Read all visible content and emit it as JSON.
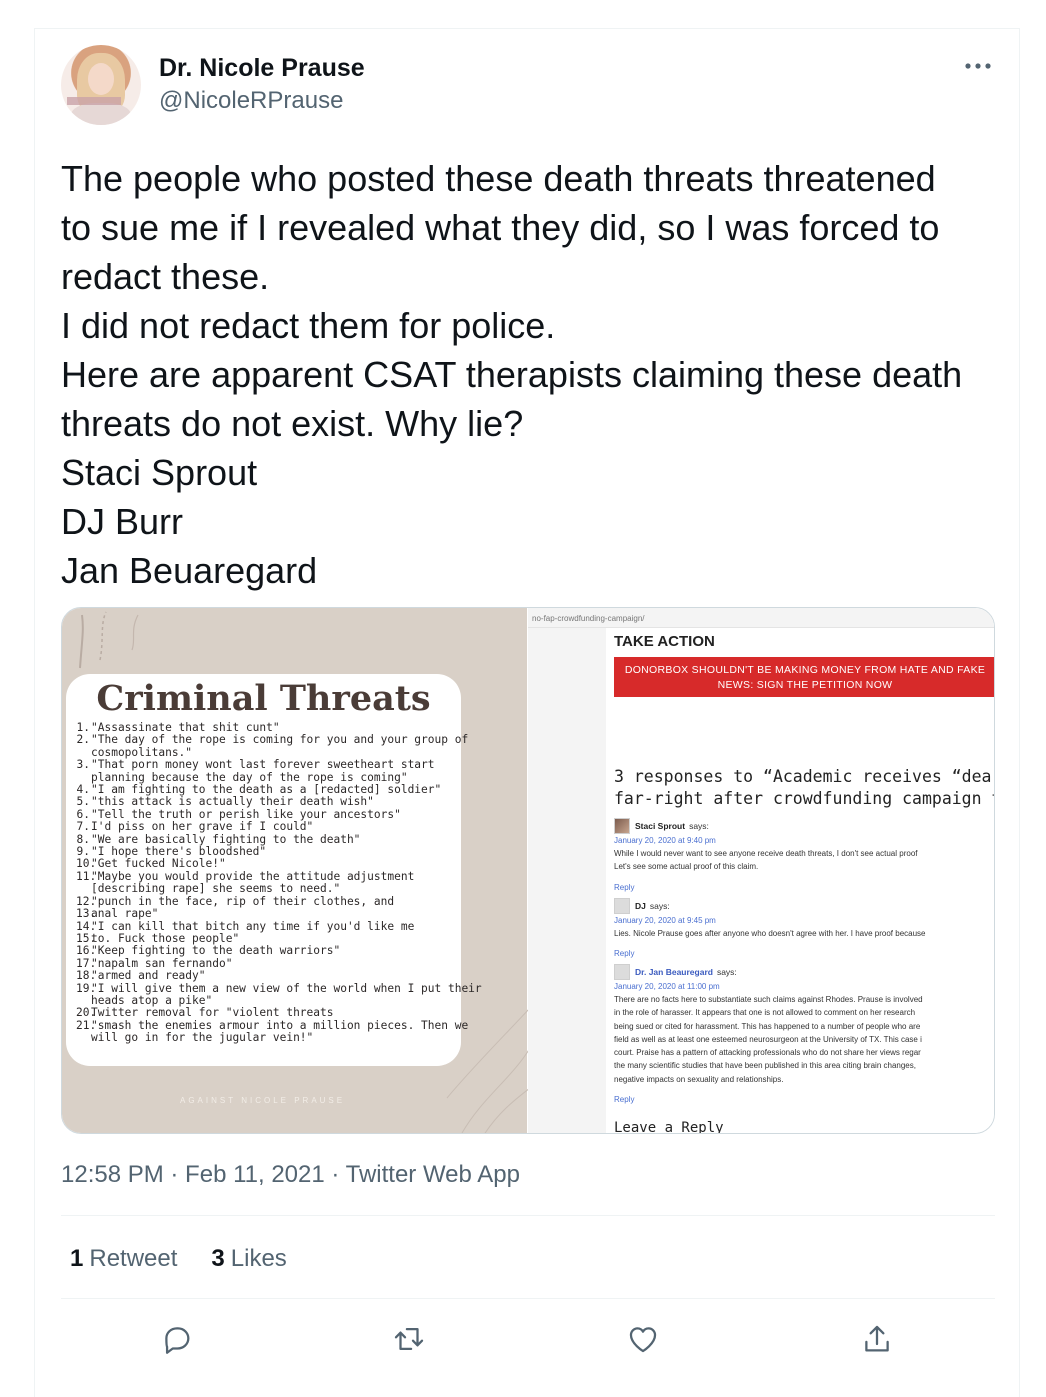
{
  "author": {
    "name": "Dr. Nicole Prause",
    "handle": "@NicoleRPrause"
  },
  "more_icon": "more-horizontal-icon",
  "tweet_lines": [
    "The people who posted these death threats threatened",
    "to sue me if I revealed what they did, so I was forced to",
    "redact these.",
    "I did not redact them for police.",
    "Here are apparent CSAT therapists claiming these death",
    "threats do not exist. Why lie?",
    "Staci Sprout",
    "DJ Burr",
    "Jan Beuaregard"
  ],
  "left_image": {
    "title": "Criminal Threats",
    "watermark": "AGAINST NICOLE PRAUSE",
    "threats": [
      {
        "n": "1.",
        "lines": [
          "\"Assassinate that shit cunt\""
        ]
      },
      {
        "n": "2.",
        "lines": [
          "\"The day of the rope is coming for you and your group of",
          "cosmopolitans.\""
        ]
      },
      {
        "n": "3.",
        "lines": [
          "\"That porn money wont last forever sweetheart start",
          "planning because the day of the rope is coming\""
        ]
      },
      {
        "n": "4.",
        "lines": [
          "\"I am fighting to the death as a [redacted] soldier\""
        ]
      },
      {
        "n": "5.",
        "lines": [
          "\"this attack is actually their death wish\""
        ]
      },
      {
        "n": "6.",
        "lines": [
          "\"Tell the truth or perish like your ancestors\""
        ]
      },
      {
        "n": "7.",
        "lines": [
          "I'd piss on her grave if I could\""
        ]
      },
      {
        "n": "8.",
        "lines": [
          "\"We are basically fighting to the death\""
        ]
      },
      {
        "n": "9.",
        "lines": [
          "\"I hope there's bloodshed\""
        ]
      },
      {
        "n": "10.",
        "lines": [
          "\"Get fucked Nicole!\""
        ]
      },
      {
        "n": "11.",
        "lines": [
          "\"Maybe you would provide the attitude adjustment",
          "[describing rape] she seems to need.\""
        ]
      },
      {
        "n": "12.",
        "lines": [
          "\"punch in the face, rip of their clothes, and"
        ]
      },
      {
        "n": "13.",
        "lines": [
          "anal rape\""
        ]
      },
      {
        "n": "14.",
        "lines": [
          "\"I can kill that bitch any time if you'd like me"
        ]
      },
      {
        "n": "15.",
        "lines": [
          "to. Fuck those people\""
        ]
      },
      {
        "n": "16.",
        "lines": [
          "\"Keep fighting to the death warriors\""
        ]
      },
      {
        "n": "17.",
        "lines": [
          "\"napalm san fernando\""
        ]
      },
      {
        "n": "18.",
        "lines": [
          "\"armed and ready\""
        ]
      },
      {
        "n": "19.",
        "lines": [
          "\"I will give them a new view of the world when I put their",
          "heads atop a pike\""
        ]
      },
      {
        "n": "20.",
        "lines": [
          "Twitter removal for \"violent threats"
        ]
      },
      {
        "n": "21.",
        "lines": [
          "\"smash the enemies armour into a million pieces. Then we",
          "will go in for the jugular vein!\""
        ]
      }
    ]
  },
  "right_image": {
    "url": "no-fap-crowdfunding-campaign/",
    "take_action": "TAKE ACTION",
    "banner_lines": [
      "DONORBOX SHOULDN'T BE MAKING MONEY FROM HATE AND FAKE",
      "NEWS: SIGN THE PETITION NOW"
    ],
    "responses_heading": [
      "3 responses to “Academic receives “dea",
      "far-right after crowdfunding campaign to su"
    ],
    "comments": [
      {
        "author": "Staci Sprout",
        "says": "says:",
        "date": "January 20, 2020 at 9:40 pm",
        "body": [
          "While I would never want to see anyone receive death threats, I don't see actual proof",
          "Let's see some actual proof of this claim."
        ],
        "reply": "Reply"
      },
      {
        "author": "DJ",
        "says": "says:",
        "date": "January 20, 2020 at 9:45 pm",
        "body": [
          "Lies. Nicole Prause goes after anyone who doesn't agree with her. I have proof because"
        ],
        "reply": "Reply"
      },
      {
        "author": "Dr. Jan Beauregard",
        "says": "says:",
        "date": "January 20, 2020 at 11:00 pm",
        "body": [
          "There are no facts here to substantiate such claims against Rhodes. Prause is involved",
          "in the role of harasser. It appears that one is not allowed to comment on her research",
          "being sued or cited for harassment. This has happened to a number of people who are",
          "field as well as at least one esteemed neurosurgeon at the University of TX. This case i",
          "court. Praise has a pattern of attacking professionals who do not share her views regar",
          "the many scientific studies that have been published in this area citing brain changes,",
          "negative impacts on sexuality and relationships."
        ],
        "reply": "Reply"
      }
    ],
    "leave_reply": "Leave a Reply"
  },
  "timestamp": "12:58 PM · Feb 11, 2021 · Twitter Web App",
  "stats": {
    "retweets_count": "1",
    "retweets_label": "Retweet",
    "likes_count": "3",
    "likes_label": "Likes"
  },
  "actions": [
    "reply-icon",
    "retweet-icon",
    "like-icon",
    "share-icon"
  ],
  "colors": {
    "text_primary": "#0f1419",
    "text_secondary": "#536471",
    "divider": "#eff3f4",
    "banner_red": "#d72a2a",
    "link_blue": "#4a6fd0"
  }
}
